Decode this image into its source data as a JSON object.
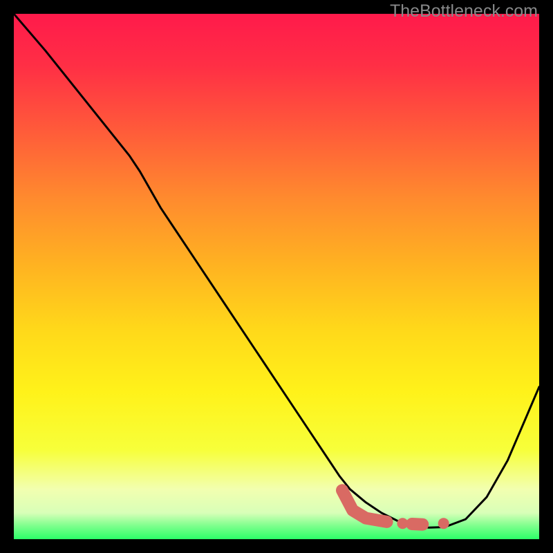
{
  "watermark": "TheBottleneck.com",
  "colors": {
    "frame": "#000000",
    "curve": "#000000",
    "marker_fill": "#d96a63",
    "marker_stroke": "#d96a63"
  },
  "gradient_stops": [
    {
      "offset": 0.0,
      "color": "#ff1a4b"
    },
    {
      "offset": 0.1,
      "color": "#ff2f45"
    },
    {
      "offset": 0.22,
      "color": "#ff5a3a"
    },
    {
      "offset": 0.35,
      "color": "#ff8a2e"
    },
    {
      "offset": 0.48,
      "color": "#ffb321"
    },
    {
      "offset": 0.6,
      "color": "#ffd81a"
    },
    {
      "offset": 0.72,
      "color": "#fff21a"
    },
    {
      "offset": 0.83,
      "color": "#f7ff3a"
    },
    {
      "offset": 0.905,
      "color": "#f2ffb0"
    },
    {
      "offset": 0.95,
      "color": "#d8ffb8"
    },
    {
      "offset": 0.975,
      "color": "#7cff8c"
    },
    {
      "offset": 1.0,
      "color": "#2cff68"
    }
  ],
  "chart_data": {
    "type": "line",
    "title": "",
    "xlabel": "",
    "ylabel": "",
    "xlim": [
      0,
      100
    ],
    "ylim": [
      0,
      100
    ],
    "legend": false,
    "series": [
      {
        "name": "bottleneck-curve",
        "x": [
          0,
          6,
          10,
          14,
          18,
          22,
          24,
          28,
          34,
          40,
          46,
          52,
          56,
          60,
          62,
          64,
          67,
          70,
          73,
          76,
          79,
          82,
          86,
          90,
          94,
          100
        ],
        "y": [
          100,
          93,
          88,
          83,
          78,
          73,
          70,
          63,
          54,
          45,
          36,
          27,
          21,
          15,
          12,
          9.5,
          7,
          5,
          3.5,
          2.6,
          2.2,
          2.3,
          3.8,
          8,
          15,
          29
        ]
      }
    ],
    "markers": [
      {
        "name": "marker-segment-a",
        "shape": "round-cap-line",
        "points": [
          {
            "x": 62.5,
            "y": 9.3
          },
          {
            "x": 64.5,
            "y": 5.5
          },
          {
            "x": 67.0,
            "y": 4.0
          },
          {
            "x": 71.0,
            "y": 3.3
          }
        ]
      },
      {
        "name": "marker-dot-b",
        "shape": "dot",
        "x": 74.0,
        "y": 3.0
      },
      {
        "name": "marker-dash-c",
        "shape": "short-dash",
        "points": [
          {
            "x": 75.8,
            "y": 2.9
          },
          {
            "x": 77.8,
            "y": 2.8
          }
        ]
      },
      {
        "name": "marker-dot-d",
        "shape": "dot",
        "x": 81.8,
        "y": 3.0
      }
    ],
    "note": "Values are read off the plot in percent-of-axis units; the chart has no visible tick labels."
  }
}
